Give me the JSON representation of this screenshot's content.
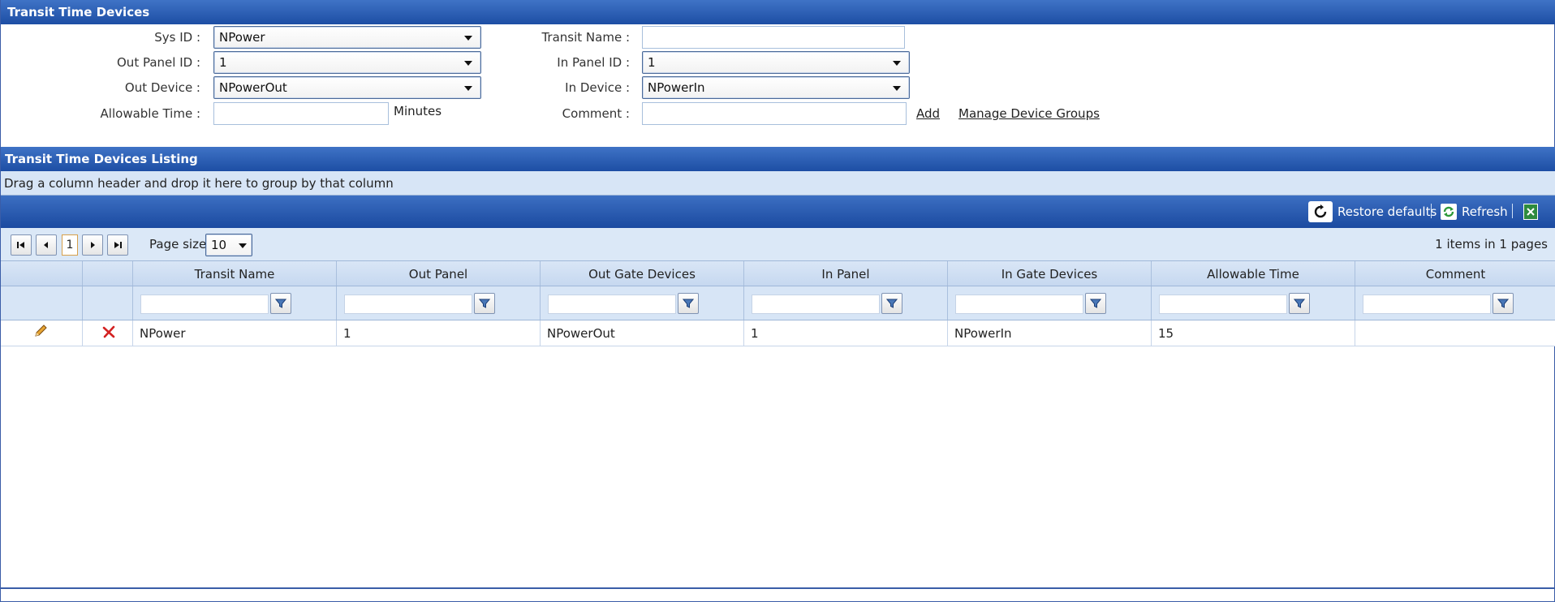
{
  "header": {
    "title": "Transit Time Devices"
  },
  "form": {
    "sys_id": {
      "label": "Sys ID :",
      "value": "NPower"
    },
    "out_panel_id": {
      "label": "Out Panel ID :",
      "value": "1"
    },
    "out_device": {
      "label": "Out Device :",
      "value": "NPowerOut"
    },
    "allowable_time": {
      "label": "Allowable Time :",
      "value": "",
      "unit": "Minutes"
    },
    "transit_name": {
      "label": "Transit Name :",
      "value": ""
    },
    "in_panel_id": {
      "label": "In Panel ID :",
      "value": "1"
    },
    "in_device": {
      "label": "In Device :",
      "value": "NPowerIn"
    },
    "comment": {
      "label": "Comment :",
      "value": ""
    },
    "add_link": "Add",
    "manage_link": "Manage Device Groups"
  },
  "listing": {
    "title": "Transit Time Devices Listing",
    "group_hint": "Drag a column header and drop it here to group by that column",
    "commands": {
      "restore": "Restore defaults",
      "refresh": "Refresh"
    },
    "pager": {
      "current_page": "1",
      "page_size_label": "Page size:",
      "page_size": "10",
      "summary": "1 items in 1 pages"
    },
    "columns": [
      "Transit Name",
      "Out Panel",
      "Out Gate Devices",
      "In Panel",
      "In Gate Devices",
      "Allowable Time",
      "Comment"
    ],
    "rows": [
      {
        "transit_name": "NPower",
        "out_panel": "1",
        "out_gate": "NPowerOut",
        "in_panel": "1",
        "in_gate": "NPowerIn",
        "allowable_time": "15",
        "comment": ""
      }
    ]
  },
  "icons": {
    "edit": "pencil-icon",
    "delete": "delete-x-icon",
    "restore": "restore-icon",
    "refresh": "refresh-icon",
    "export": "excel-export-icon",
    "filter": "filter-icon"
  },
  "colors": {
    "header_blue": "#1d4ea4",
    "grid_light": "#d7e5f6"
  }
}
